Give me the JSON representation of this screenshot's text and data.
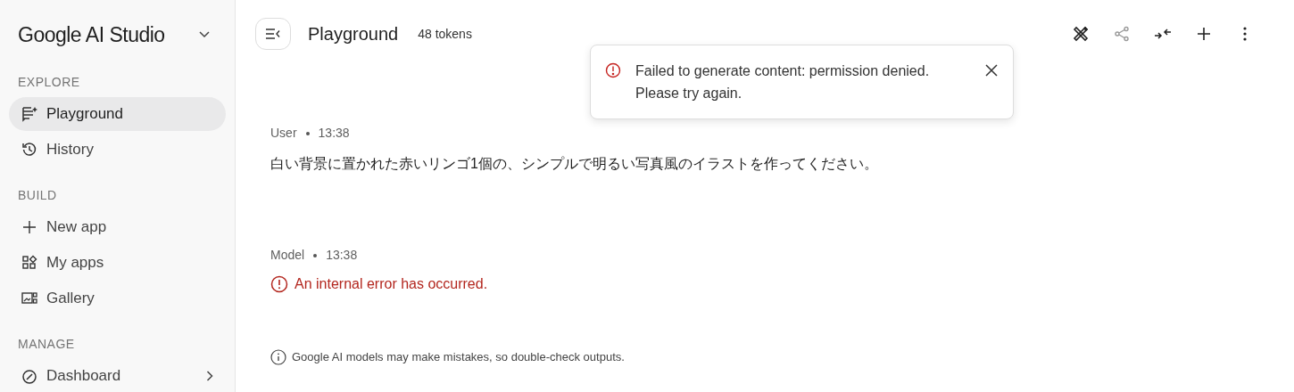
{
  "app": {
    "title": "Google AI Studio"
  },
  "sidebar": {
    "sections": [
      {
        "heading": "EXPLORE",
        "items": [
          {
            "label": "Playground",
            "selected": true,
            "has_submenu": false
          },
          {
            "label": "History",
            "selected": false,
            "has_submenu": false
          }
        ]
      },
      {
        "heading": "BUILD",
        "items": [
          {
            "label": "New app",
            "selected": false,
            "has_submenu": false
          },
          {
            "label": "My apps",
            "selected": false,
            "has_submenu": false
          },
          {
            "label": "Gallery",
            "selected": false,
            "has_submenu": false
          }
        ]
      },
      {
        "heading": "MANAGE",
        "items": [
          {
            "label": "Dashboard",
            "selected": false,
            "has_submenu": true
          }
        ]
      }
    ]
  },
  "header": {
    "title": "Playground",
    "tokens": "48 tokens"
  },
  "toast": {
    "message": "Failed to generate content: permission denied. Please try again."
  },
  "messages": [
    {
      "role": "User",
      "time": "13:38",
      "kind": "text",
      "text": "白い背景に置かれた赤いリンゴ1個の、シンプルで明るい写真風のイラストを作ってください。"
    },
    {
      "role": "Model",
      "time": "13:38",
      "kind": "error",
      "text": "An internal error has occurred."
    }
  ],
  "disclaimer": "Google AI models may make mistakes, so double-check outputs."
}
